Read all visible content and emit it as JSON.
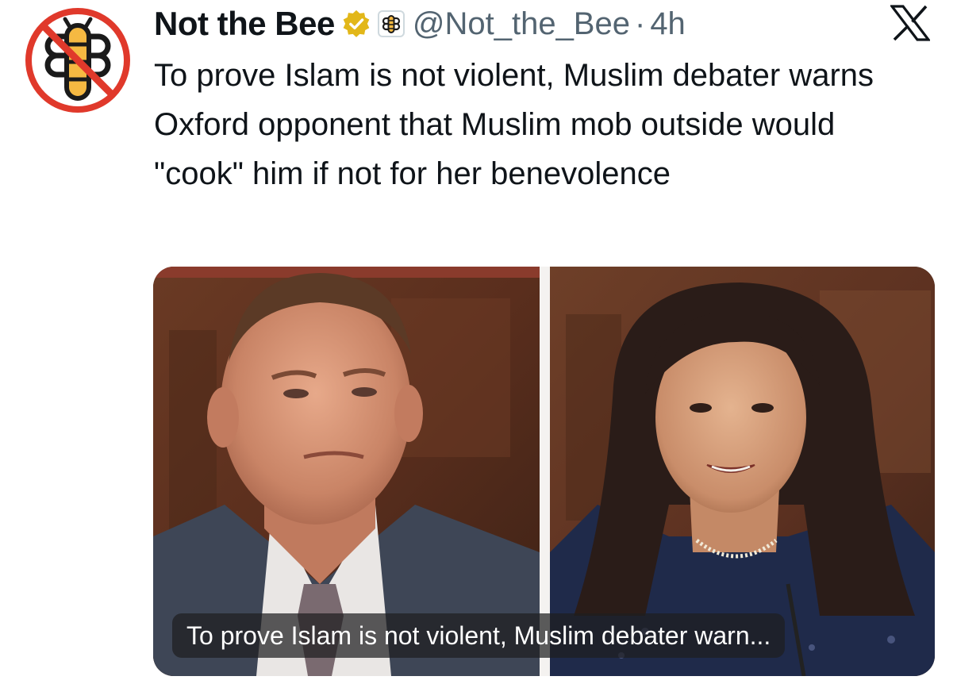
{
  "author": {
    "display_name": "Not the Bee",
    "handle": "@Not_the_Bee",
    "separator": "·",
    "time": "4h"
  },
  "tweet": {
    "text": "To prove Islam is not violent, Muslim debater warns Oxford opponent that Muslim mob outside would \"cook\" him if not for her benevolence"
  },
  "media": {
    "caption": "To prove Islam is not violent, Muslim debater warn..."
  },
  "icons": {
    "avatar": "not-the-bee-logo",
    "verified": "gold-verified-badge",
    "affiliate": "bee-affiliate-badge",
    "platform": "x-logo"
  },
  "colors": {
    "text_primary": "#0f1419",
    "text_secondary": "#536471",
    "verified_gold": "#e2b719",
    "logo_red": "#e0392b",
    "logo_yellow": "#f5b942"
  }
}
